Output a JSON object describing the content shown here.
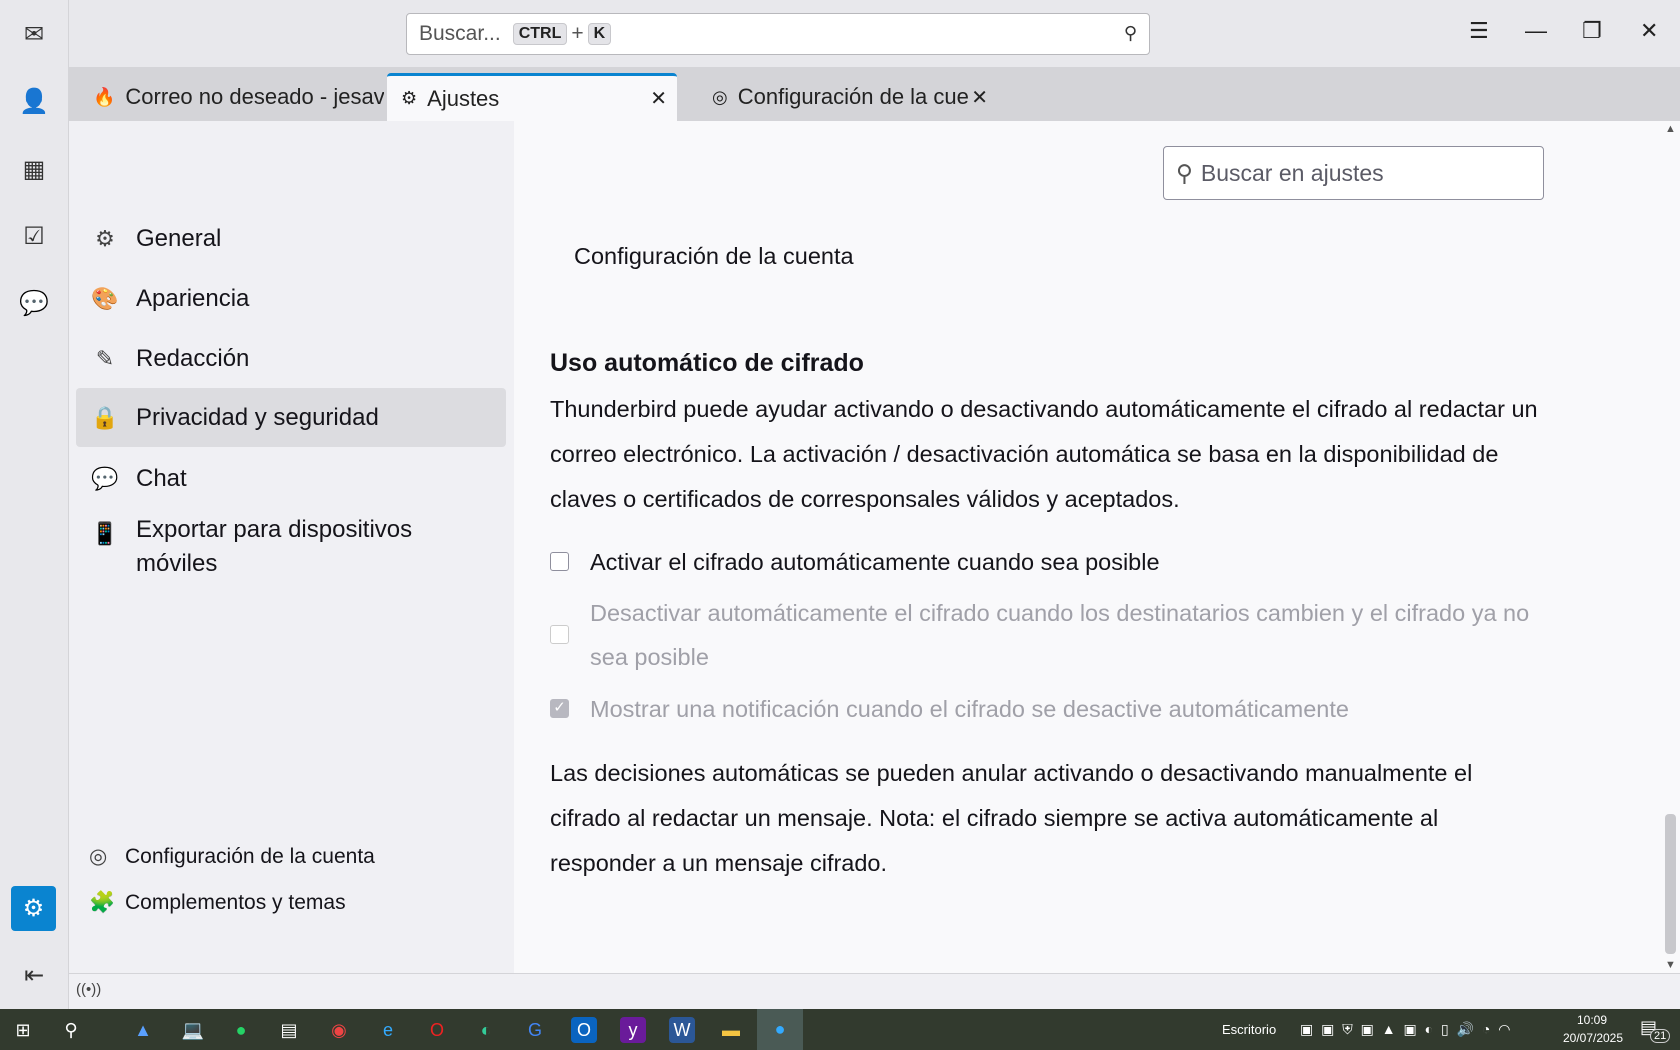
{
  "toolbar": {
    "search_placeholder": "Buscar...",
    "shortcut_ctrl": "CTRL",
    "shortcut_plus": "+",
    "shortcut_k": "K"
  },
  "tabs": [
    {
      "label": "Correo no deseado - jesav",
      "icon": "junk-icon"
    },
    {
      "label": "Ajustes",
      "icon": "gear-icon"
    },
    {
      "label": "Configuración de la cue",
      "icon": "account-icon"
    }
  ],
  "sidebar": {
    "items": [
      {
        "label": "General"
      },
      {
        "label": "Apariencia"
      },
      {
        "label": "Redacción"
      },
      {
        "label": "Privacidad y seguridad"
      },
      {
        "label": "Chat"
      },
      {
        "label": "Exportar para dispositivos móviles"
      }
    ],
    "footer": [
      {
        "label": "Configuración de la cuenta"
      },
      {
        "label": "Complementos y temas"
      }
    ]
  },
  "content": {
    "search_placeholder": "Buscar en ajustes",
    "account_link": "Configuración de la cuenta",
    "heading": "Uso automático de cifrado",
    "description": "Thunderbird puede ayudar activando o desactivando automáticamente el cifrado al redactar un correo electrónico. La activación / desactivación automática se basa en la disponibilidad de claves o certificados de corresponsales válidos y aceptados.",
    "options": [
      {
        "label": "Activar el cifrado automáticamente cuando sea posible",
        "checked": false,
        "disabled": false
      },
      {
        "label": "Desactivar automáticamente el cifrado cuando los destinatarios cambien y el cifrado ya no sea posible",
        "checked": false,
        "disabled": true
      },
      {
        "label": "Mostrar una notificación cuando el cifrado se desactive automáticamente",
        "checked": true,
        "disabled": true
      }
    ],
    "note": "Las decisiones automáticas se pueden anular activando o desactivando manualmente el cifrado al redactar un mensaje. Nota: el cifrado siempre se activa automáticamente al responder a un mensaje cifrado."
  },
  "taskbar": {
    "desktop_label": "Escritorio",
    "time": "10:09",
    "date": "20/07/2025",
    "notifications": "21"
  },
  "colors": {
    "accent": "#0a84d0",
    "taskbar": "#323a2e"
  }
}
